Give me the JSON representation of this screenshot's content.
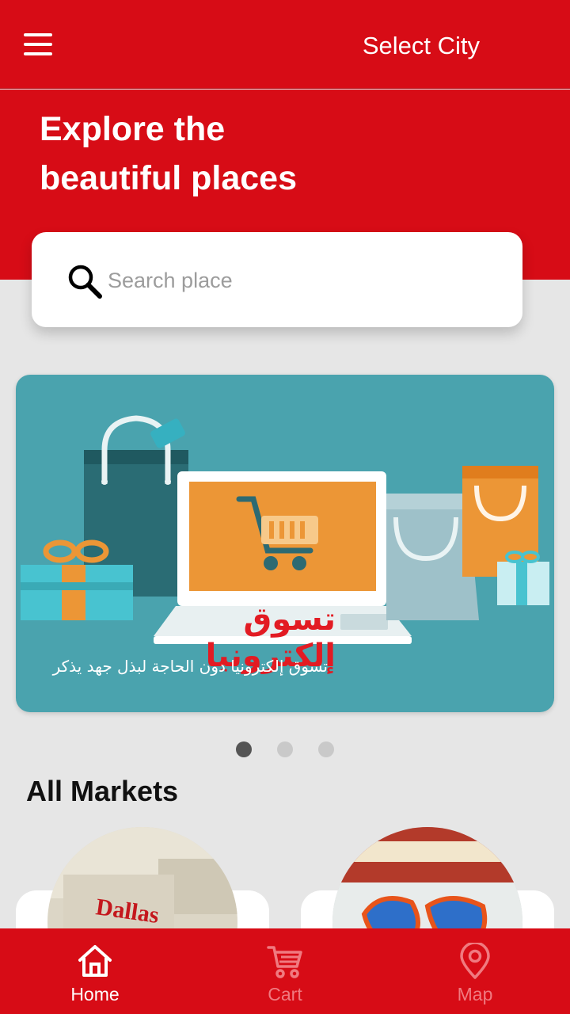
{
  "appbar": {
    "menu_icon": "hamburger-menu-icon",
    "select_city_label": "Select City"
  },
  "hero": {
    "title_line1": "Explore the",
    "title_line2": "beautiful places"
  },
  "search": {
    "placeholder": "Search place",
    "icon": "search-icon"
  },
  "banner": {
    "title": "تسوق إلكترونيا",
    "subtitle": "تسوق إلكترونيا دون الحاجة لبذل جهد يذكر",
    "slide_count": 3,
    "active_slide": 1
  },
  "section": {
    "title": "All Markets"
  },
  "markets": [
    {
      "image": "dallas-store-photo"
    },
    {
      "image": "supermarket-sign-photo"
    }
  ],
  "bottom_nav": {
    "items": [
      {
        "label": "Home",
        "icon": "home-icon",
        "active": true
      },
      {
        "label": "Cart",
        "icon": "cart-icon",
        "active": false
      },
      {
        "label": "Map",
        "icon": "map-pin-icon",
        "active": false
      }
    ]
  },
  "colors": {
    "primary": "#d70c16",
    "background": "#e6e6e6",
    "banner": "#4aa3ae",
    "inactive_nav": "#f07a80"
  }
}
